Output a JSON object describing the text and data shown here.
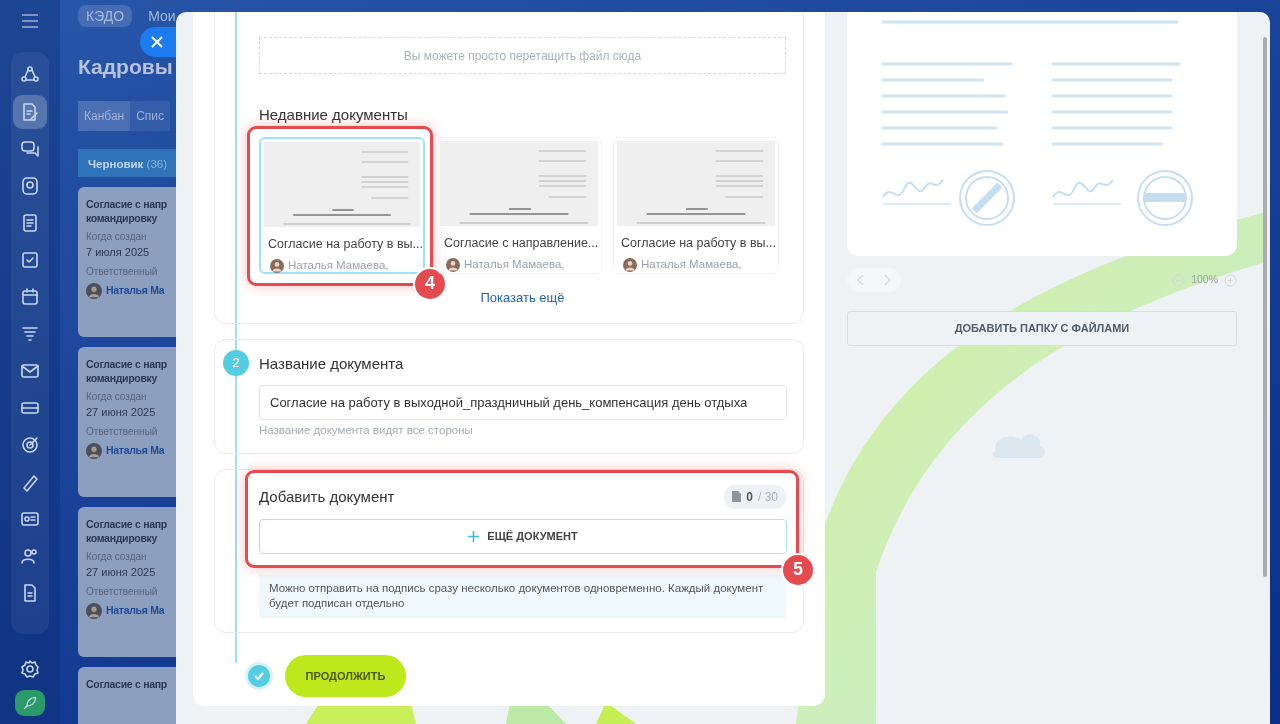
{
  "sidebar": {
    "items": [
      {
        "selected": false
      },
      {
        "selected": true
      },
      {
        "selected": false
      },
      {
        "selected": false
      },
      {
        "selected": false
      },
      {
        "selected": false
      },
      {
        "selected": false
      },
      {
        "selected": false
      },
      {
        "selected": false
      },
      {
        "selected": false
      },
      {
        "selected": false
      },
      {
        "selected": false
      },
      {
        "selected": false
      },
      {
        "selected": false
      },
      {
        "selected": false
      }
    ]
  },
  "header": {
    "tabs": [
      {
        "label": "КЭДО",
        "selected": true
      },
      {
        "label": "Мои",
        "selected": false
      }
    ]
  },
  "page_title": "Кадровы",
  "view_switch": [
    {
      "label": "Канбан",
      "selected": true
    },
    {
      "label": "Спис",
      "selected": false
    }
  ],
  "kanban": {
    "column": {
      "title": "Черновик",
      "count": "(36)"
    },
    "cards": [
      {
        "title_lines": [
          "Согласие с напр",
          "командировку"
        ],
        "created_label": "Когда создан",
        "created": "7 июля 2025",
        "responsible_label": "Ответственный",
        "responsible": "Наталья Ма"
      },
      {
        "title_lines": [
          "Согласие с напр",
          "командировку"
        ],
        "created_label": "Когда создан",
        "created": "27 июня 2025",
        "responsible_label": "Ответственный",
        "responsible": "Наталья Ма"
      },
      {
        "title_lines": [
          "Согласие с напр",
          "командировку"
        ],
        "created_label": "Когда создан",
        "created": "27 июня 2025",
        "responsible_label": "Ответственный",
        "responsible": "Наталья Ма"
      },
      {
        "title_lines": [
          "Согласие с напр"
        ]
      }
    ]
  },
  "form": {
    "drop_zone": "Вы можете просто перетащить файл сюда",
    "recent": {
      "title": "Недавние документы",
      "documents": [
        {
          "title": "Согласие на работу в вы...",
          "author": "Наталья Мамаева,",
          "selected": true
        },
        {
          "title": "Согласие с направление...",
          "author": "Наталья Мамаева,",
          "selected": false
        },
        {
          "title": "Согласие на работу в вы...",
          "author": "Наталья Мамаева,",
          "selected": false
        }
      ],
      "show_more": "Показать ещё"
    },
    "name_step": {
      "number": "2",
      "title": "Название документа",
      "value": "Согласие на работу в выходной_праздничный день_компенсация день отдыха",
      "hint": "Название документа видят все стороны"
    },
    "add_step": {
      "title": "Добавить документ",
      "counter_current": "0",
      "counter_total": "/ 30",
      "button": "ЕЩЁ ДОКУМЕНТ",
      "info": "Можно отправить на подпись сразу несколько документов одновременно. Каждый документ будет подписан отдельно"
    },
    "continue_button": "ПРОДОЛЖИТЬ"
  },
  "preview": {
    "zoom": "100%",
    "folder_button": "ДОБАВИТЬ ПАПКУ С ФАЙЛАМИ"
  },
  "annotations": [
    {
      "label": "4"
    },
    {
      "label": "5"
    }
  ]
}
